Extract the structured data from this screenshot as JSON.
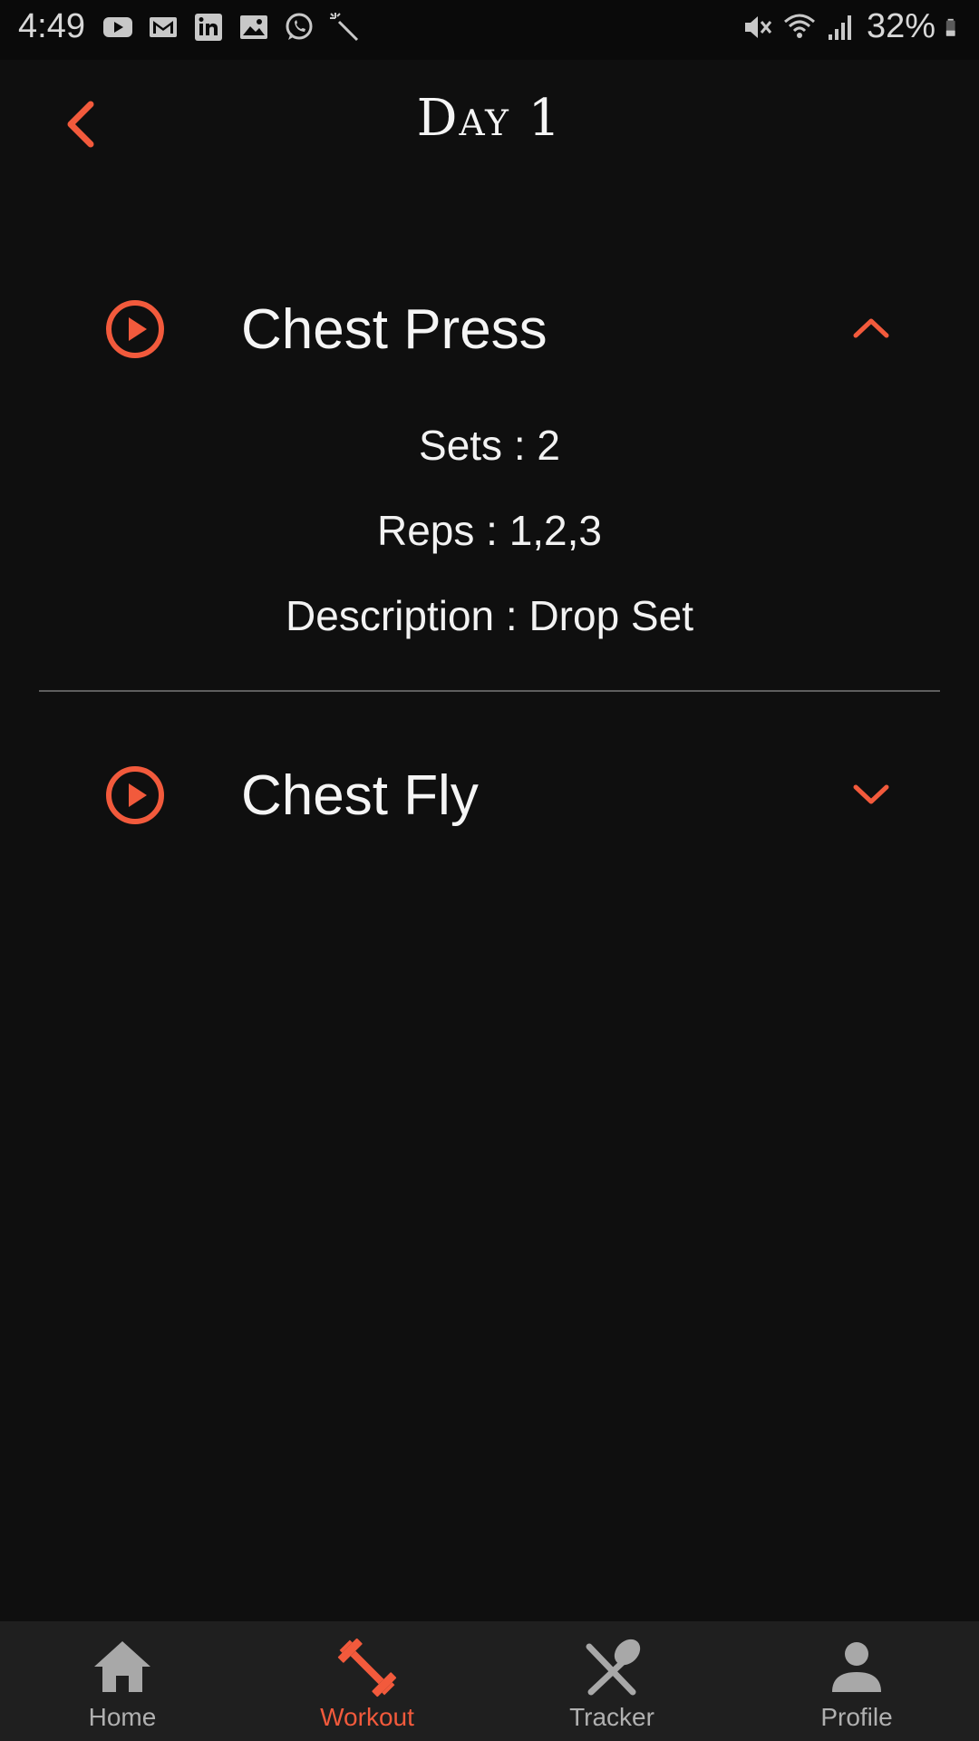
{
  "status_bar": {
    "time": "4:49",
    "battery_percent": "32%",
    "left_icons": [
      "youtube-icon",
      "gmail-icon",
      "linkedin-icon",
      "gallery-icon",
      "whatsapp-icon",
      "magic-wand-icon"
    ],
    "right_icons": [
      "vibrate-mute-icon",
      "wifi-icon",
      "signal-icon",
      "battery-icon"
    ]
  },
  "header": {
    "title": "Day 1",
    "back_icon": "chevron-left-icon"
  },
  "exercises": [
    {
      "name": "Chest Press",
      "expanded": true,
      "details": {
        "sets": "Sets : 2",
        "reps": "Reps : 1,2,3",
        "description": "Description : Drop Set"
      }
    },
    {
      "name": "Chest Fly",
      "expanded": false
    }
  ],
  "bottom_nav": {
    "items": [
      {
        "label": "Home",
        "icon": "home-icon",
        "active": false
      },
      {
        "label": "Workout",
        "icon": "dumbbell-icon",
        "active": true
      },
      {
        "label": "Tracker",
        "icon": "fork-spoon-icon",
        "active": false
      },
      {
        "label": "Profile",
        "icon": "person-icon",
        "active": false
      }
    ]
  },
  "colors": {
    "accent": "#f25a3c",
    "background": "#0f0f0f",
    "nav_background": "#1f1f1f",
    "inactive": "#b0b0b0"
  }
}
